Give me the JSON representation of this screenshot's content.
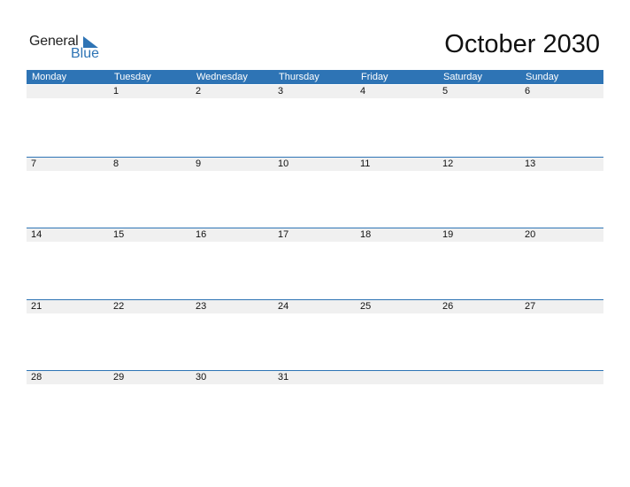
{
  "logo": {
    "word1": "General",
    "word2": "Blue"
  },
  "title": "October 2030",
  "colors": {
    "accent": "#2e74b5",
    "strip": "#f0f0f0"
  },
  "weekdays": [
    "Monday",
    "Tuesday",
    "Wednesday",
    "Thursday",
    "Friday",
    "Saturday",
    "Sunday"
  ],
  "weeks": [
    [
      "",
      "1",
      "2",
      "3",
      "4",
      "5",
      "6"
    ],
    [
      "7",
      "8",
      "9",
      "10",
      "11",
      "12",
      "13"
    ],
    [
      "14",
      "15",
      "16",
      "17",
      "18",
      "19",
      "20"
    ],
    [
      "21",
      "22",
      "23",
      "24",
      "25",
      "26",
      "27"
    ],
    [
      "28",
      "29",
      "30",
      "31",
      "",
      "",
      ""
    ]
  ]
}
